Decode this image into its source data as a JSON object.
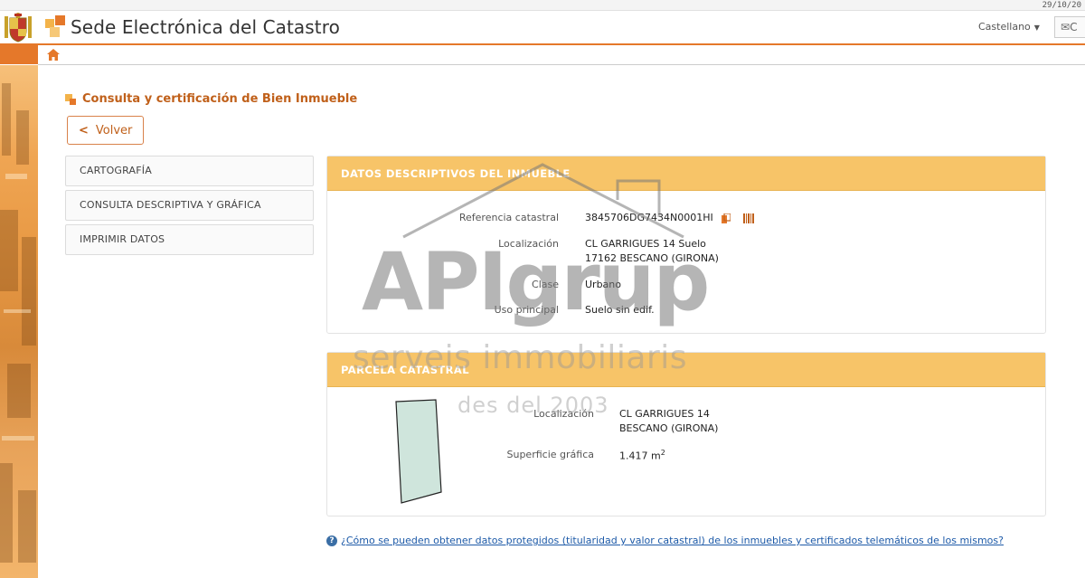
{
  "topbar": {
    "date": "29/10/20"
  },
  "header": {
    "site_title": "Sede Electrónica del Catastro",
    "language": "Castellano",
    "contact_label": "C"
  },
  "page": {
    "title": "Consulta y certificación de Bien Inmueble",
    "back_label": "Volver"
  },
  "side_menu": {
    "items": [
      {
        "label": "CARTOGRAFÍA"
      },
      {
        "label": "CONSULTA DESCRIPTIVA Y GRÁFICA"
      },
      {
        "label": "IMPRIMIR DATOS"
      }
    ]
  },
  "datos": {
    "title": "DATOS DESCRIPTIVOS DEL INMUEBLE",
    "ref_label": "Referencia catastral",
    "ref_value": "3845706DG7434N0001HI",
    "loc_label": "Localización",
    "loc_line1": "CL GARRIGUES 14 Suelo",
    "loc_line2": "17162 BESCANO (GIRONA)",
    "clase_label": "Clase",
    "clase_value": "Urbano",
    "uso_label": "Uso principal",
    "uso_value": "Suelo sin edif."
  },
  "parcela": {
    "title": "PARCELA CATASTRAL",
    "loc_label": "Localización",
    "loc_line1": "CL GARRIGUES 14",
    "loc_line2": "BESCANO (GIRONA)",
    "sup_label": "Superficie gráfica",
    "sup_value": "1.417 m",
    "sup_unit_sup": "2"
  },
  "help": {
    "text": "¿Cómo se pueden obtener datos protegidos (titularidad y valor catastral) de los inmuebles y certificados telemáticos de los mismos?"
  },
  "watermark": {
    "main": "APIgrup",
    "sub": "serveis immobiliaris",
    "year": "des del 2003"
  },
  "colors": {
    "accent": "#e5782a",
    "panel_header": "#f7c468",
    "title_orange": "#c0601a",
    "link_blue": "#1d5aa8"
  }
}
